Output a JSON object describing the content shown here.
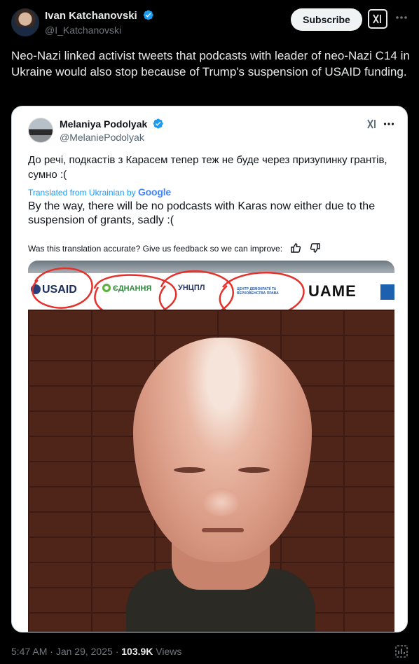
{
  "author": {
    "name": "Ivan Katchanovski",
    "handle": "@I_Katchanovski"
  },
  "actions": {
    "subscribe_label": "Subscribe"
  },
  "tweet": {
    "text": "Neo-Nazi linked activist tweets that podcasts with leader of neo-Nazi C14 in Ukraine would also stop because of Trump's suspension of USAID funding."
  },
  "quote": {
    "name": "Melaniya Podolyak",
    "handle": "@MelaniePodolyak",
    "original_text": "До речі, подкастів з Карасем тепер теж не буде через призупинку грантів, сумно :(",
    "translated_from": "Translated from Ukrainian by",
    "translator": "Google",
    "translated_text": "By the way, there will be no podcasts with Karas now either due to the suspension of grants, sadly :(",
    "feedback_prompt": "Was this translation accurate? Give us feedback so we can improve:",
    "media_logos": [
      "USAID",
      "ЄДНАННЯ",
      "УНЦПЛ",
      "ЦЕНТР ДЕМОКРАТІЇ ТА ВЕРХОВЕНСТВА ПРАВА",
      "UAME"
    ]
  },
  "meta": {
    "time": "5:47 AM",
    "date": "Jan 29, 2025",
    "views_count": "103.9K",
    "views_label": "Views",
    "separator": "·"
  },
  "colors": {
    "background": "#000000",
    "accent": "#1d9bf0",
    "annotation_red": "#e5312b"
  }
}
